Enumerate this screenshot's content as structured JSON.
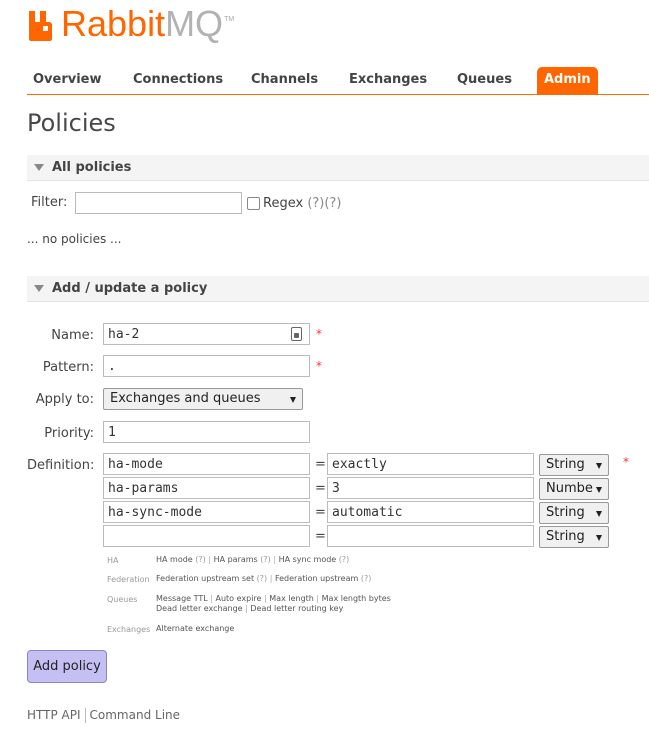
{
  "logo": {
    "rabbit": "Rabbit",
    "mq": "MQ",
    "tm": "TM",
    "color": "#ff6600"
  },
  "nav": [
    {
      "label": "Overview"
    },
    {
      "label": "Connections"
    },
    {
      "label": "Channels"
    },
    {
      "label": "Exchanges"
    },
    {
      "label": "Queues"
    },
    {
      "label": "Admin",
      "active": true
    }
  ],
  "page_title": "Policies",
  "all_policies": {
    "header": "All policies",
    "filter_label": "Filter:",
    "filter_value": "",
    "regex_label": "Regex",
    "regex_help1": "(?)",
    "regex_help2": "(?)",
    "regex_checked": false,
    "empty_text": "... no policies ..."
  },
  "add_policy": {
    "header": "Add / update a policy",
    "name_label": "Name:",
    "name_value": "ha-2",
    "pattern_label": "Pattern:",
    "pattern_value": ".",
    "apply_label": "Apply to:",
    "apply_value": "Exchanges and queues",
    "priority_label": "Priority:",
    "priority_value": "1",
    "definition_label": "Definition:",
    "required_mark": "*",
    "eq": "=",
    "definitions": [
      {
        "key": "ha-mode",
        "value": "exactly",
        "type": "String"
      },
      {
        "key": "ha-params",
        "value": "3",
        "type": "Numbe"
      },
      {
        "key": "ha-sync-mode",
        "value": "automatic",
        "type": "String"
      },
      {
        "key": "",
        "value": "",
        "type": "String"
      }
    ],
    "hints": {
      "ha": {
        "category": "HA",
        "items": [
          "HA mode",
          "HA params",
          "HA sync mode"
        ],
        "q": "(?)"
      },
      "federation": {
        "category": "Federation",
        "items": [
          "Federation upstream set",
          "Federation upstream"
        ]
      },
      "queues": {
        "category": "Queues",
        "line1": [
          "Message TTL",
          "Auto expire",
          "Max length",
          "Max length bytes"
        ],
        "line2": [
          "Dead letter exchange",
          "Dead letter routing key"
        ]
      },
      "exchanges": {
        "category": "Exchanges",
        "items": [
          "Alternate exchange"
        ]
      }
    },
    "sep": "|",
    "submit_label": "Add policy"
  },
  "footer": {
    "http_api": "HTTP API",
    "command_line": "Command Line"
  }
}
